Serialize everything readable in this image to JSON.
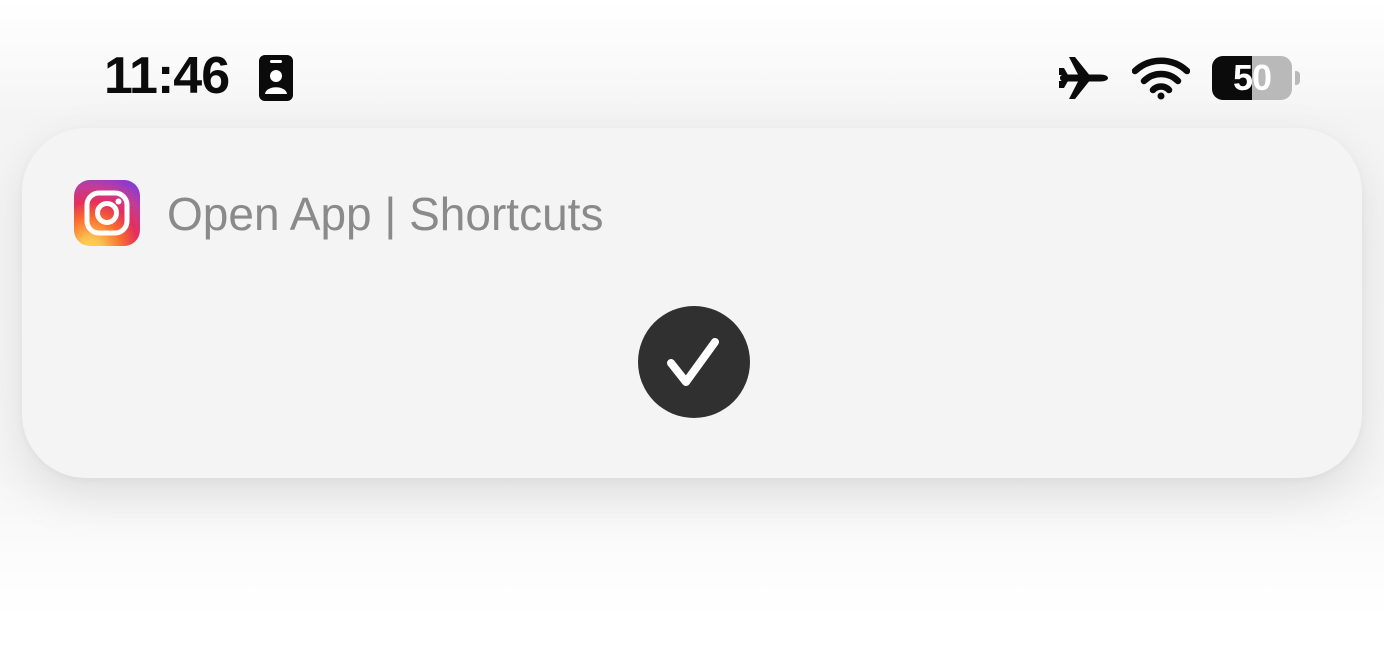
{
  "status_bar": {
    "time": "11:46",
    "focus_icon": "person-badge-icon",
    "airplane_icon": "airplane-icon",
    "wifi_icon": "wifi-icon",
    "battery_percent": "50",
    "battery_level": 0.5
  },
  "banner": {
    "app_icon": "instagram-icon",
    "title": "Open App | Shortcuts",
    "status_icon": "checkmark-icon"
  },
  "colors": {
    "text_primary": "#0b0b0b",
    "banner_background": "#f4f4f4",
    "banner_title": "#8a8a8a",
    "check_circle": "#303030"
  }
}
